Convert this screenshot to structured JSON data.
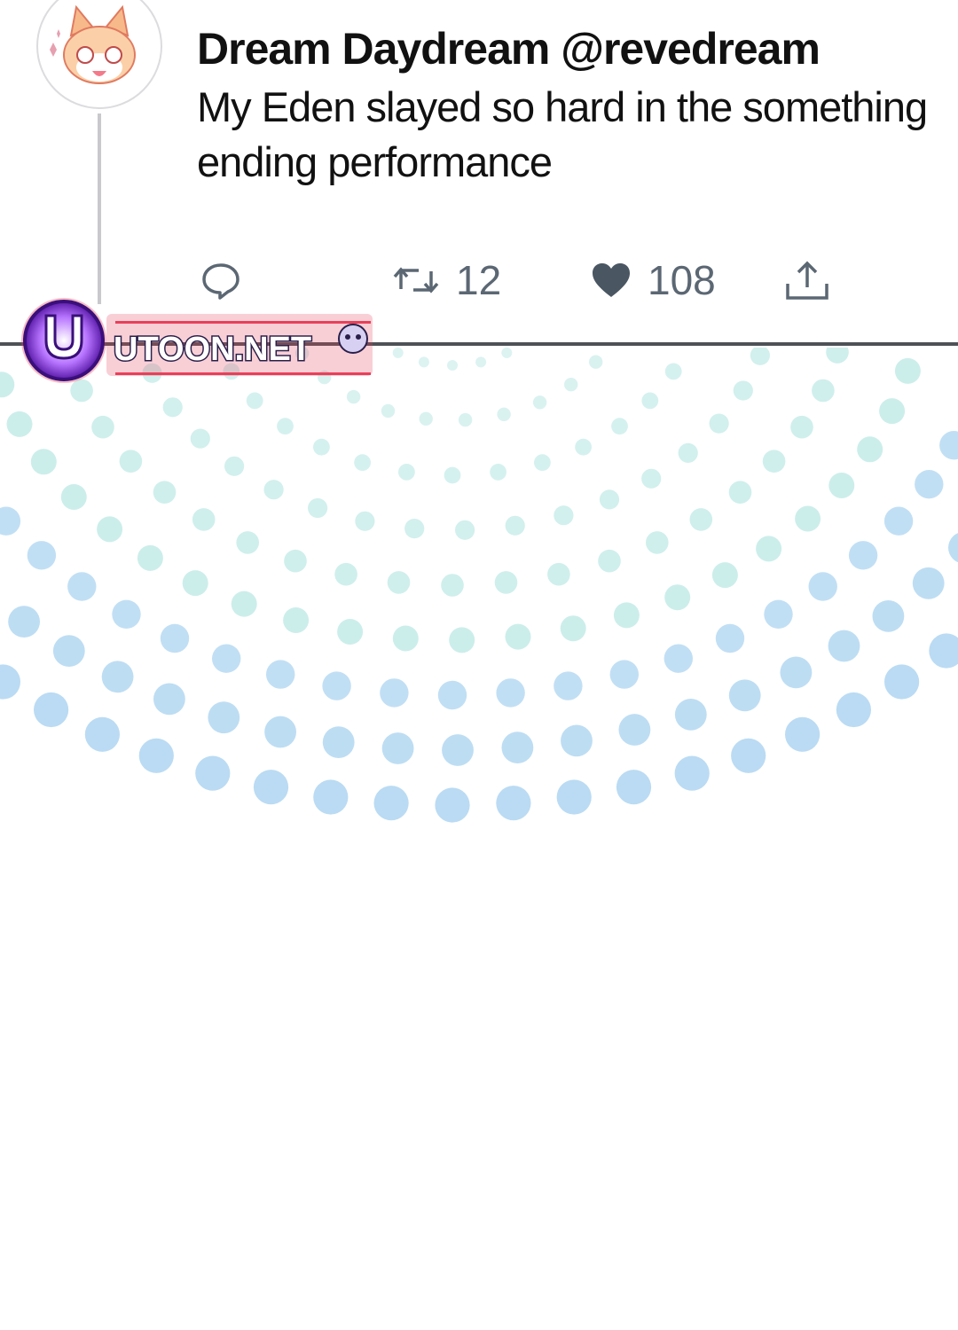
{
  "tweet": {
    "author": "Dream Daydream @revedream",
    "text": "My Eden slayed so hard in the something ending performance",
    "actions": {
      "reply_icon": "speech-bubble-icon",
      "retweet_icon": "retweet-icon",
      "retweet_count": "12",
      "like_icon": "heart-icon",
      "like_count": "108",
      "share_icon": "share-upload-icon"
    }
  },
  "watermark": {
    "text": "UTOON.NET"
  },
  "colors": {
    "icon_gray": "#5b6773",
    "thread_line": "#c9c9cc",
    "divider": "#4e5256",
    "dot_teal": "#bfeae6",
    "dot_blue": "#b6d9f2",
    "watermark_purple": "#7b2bd6",
    "watermark_red": "#e8405a"
  }
}
